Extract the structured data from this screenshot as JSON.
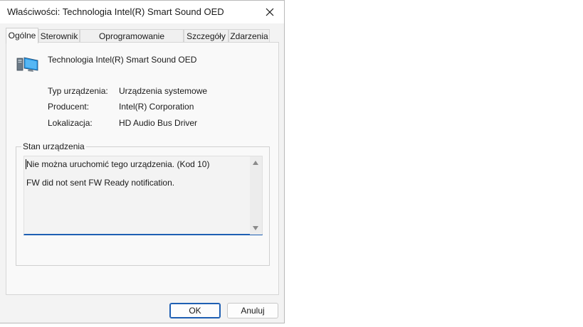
{
  "window": {
    "title": "Właściwości: Technologia Intel(R) Smart Sound OED",
    "close_icon": "close-icon"
  },
  "tabs": [
    {
      "label": "Ogólne",
      "active": true
    },
    {
      "label": "Sterownik",
      "active": false
    },
    {
      "label": "Oprogramowanie układowe",
      "active": false
    },
    {
      "label": "Szczegóły",
      "active": false
    },
    {
      "label": "Zdarzenia",
      "active": false
    }
  ],
  "device": {
    "icon": "computer-device-icon",
    "name": "Technologia Intel(R) Smart Sound OED"
  },
  "properties": [
    {
      "label": "Typ urządzenia:",
      "value": "Urządzenia systemowe"
    },
    {
      "label": "Producent:",
      "value": "Intel(R) Corporation"
    },
    {
      "label": "Lokalizacja:",
      "value": "HD Audio Bus Driver"
    }
  ],
  "status_group": {
    "legend": "Stan urządzenia",
    "line1": "Nie można uruchomić tego urządzenia. (Kod 10)",
    "line2": "FW did not sent FW Ready notification."
  },
  "buttons": {
    "ok": "OK",
    "cancel": "Anuluj"
  },
  "colors": {
    "accent": "#1e5fb3",
    "dialog_bg": "#f3f3f3"
  }
}
